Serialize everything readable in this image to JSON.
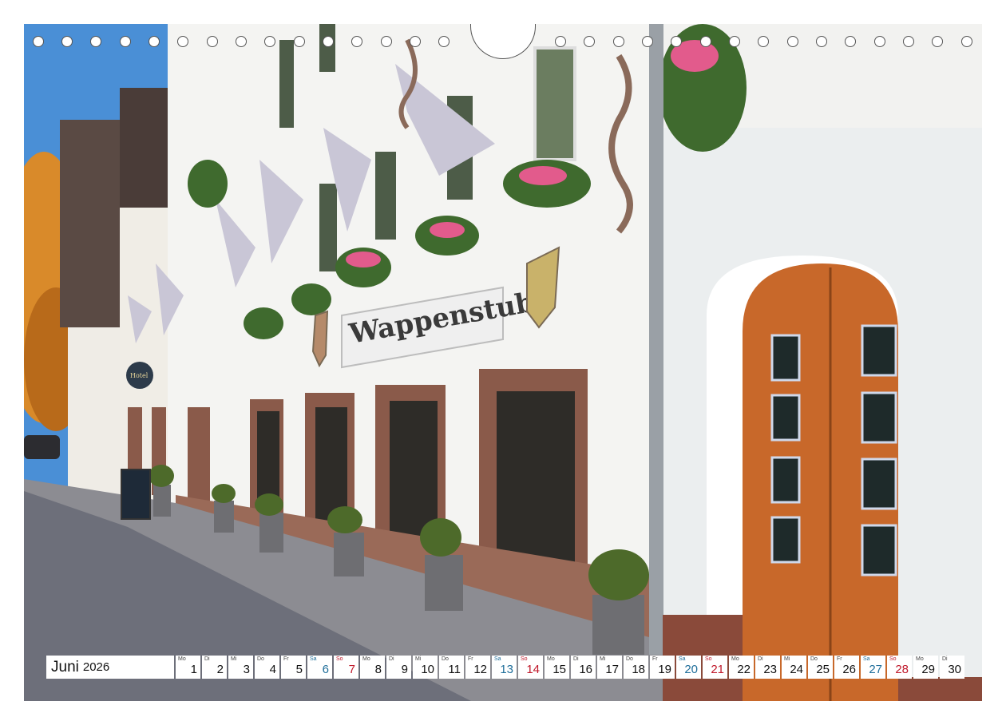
{
  "calendar": {
    "month": "Juni",
    "year": "2026",
    "days": [
      {
        "wd": "Mo",
        "n": "1",
        "kind": "week"
      },
      {
        "wd": "Di",
        "n": "2",
        "kind": "week"
      },
      {
        "wd": "Mi",
        "n": "3",
        "kind": "week"
      },
      {
        "wd": "Do",
        "n": "4",
        "kind": "week"
      },
      {
        "wd": "Fr",
        "n": "5",
        "kind": "week"
      },
      {
        "wd": "Sa",
        "n": "6",
        "kind": "sat"
      },
      {
        "wd": "So",
        "n": "7",
        "kind": "sun"
      },
      {
        "wd": "Mo",
        "n": "8",
        "kind": "week"
      },
      {
        "wd": "Di",
        "n": "9",
        "kind": "week"
      },
      {
        "wd": "Mi",
        "n": "10",
        "kind": "week"
      },
      {
        "wd": "Do",
        "n": "11",
        "kind": "week"
      },
      {
        "wd": "Fr",
        "n": "12",
        "kind": "week"
      },
      {
        "wd": "Sa",
        "n": "13",
        "kind": "sat"
      },
      {
        "wd": "So",
        "n": "14",
        "kind": "sun"
      },
      {
        "wd": "Mo",
        "n": "15",
        "kind": "week"
      },
      {
        "wd": "Di",
        "n": "16",
        "kind": "week"
      },
      {
        "wd": "Mi",
        "n": "17",
        "kind": "week"
      },
      {
        "wd": "Do",
        "n": "18",
        "kind": "week"
      },
      {
        "wd": "Fr",
        "n": "19",
        "kind": "week"
      },
      {
        "wd": "Sa",
        "n": "20",
        "kind": "sat"
      },
      {
        "wd": "So",
        "n": "21",
        "kind": "sun"
      },
      {
        "wd": "Mo",
        "n": "22",
        "kind": "week"
      },
      {
        "wd": "Di",
        "n": "23",
        "kind": "week"
      },
      {
        "wd": "Mi",
        "n": "24",
        "kind": "week"
      },
      {
        "wd": "Do",
        "n": "25",
        "kind": "week"
      },
      {
        "wd": "Fr",
        "n": "26",
        "kind": "week"
      },
      {
        "wd": "Sa",
        "n": "27",
        "kind": "sat"
      },
      {
        "wd": "So",
        "n": "28",
        "kind": "sun"
      },
      {
        "wd": "Mo",
        "n": "29",
        "kind": "week"
      },
      {
        "wd": "Di",
        "n": "30",
        "kind": "week"
      }
    ]
  },
  "photo": {
    "sign_text": "Wappenstube",
    "hotel_sign": "Hotel"
  },
  "colors": {
    "sky": "#4a8fd6",
    "facade": "#f4f4f2",
    "door": "#c8682a",
    "frame": "#8a5a4a",
    "saturday": "#1f6e9a",
    "sunday": "#c0182a"
  }
}
